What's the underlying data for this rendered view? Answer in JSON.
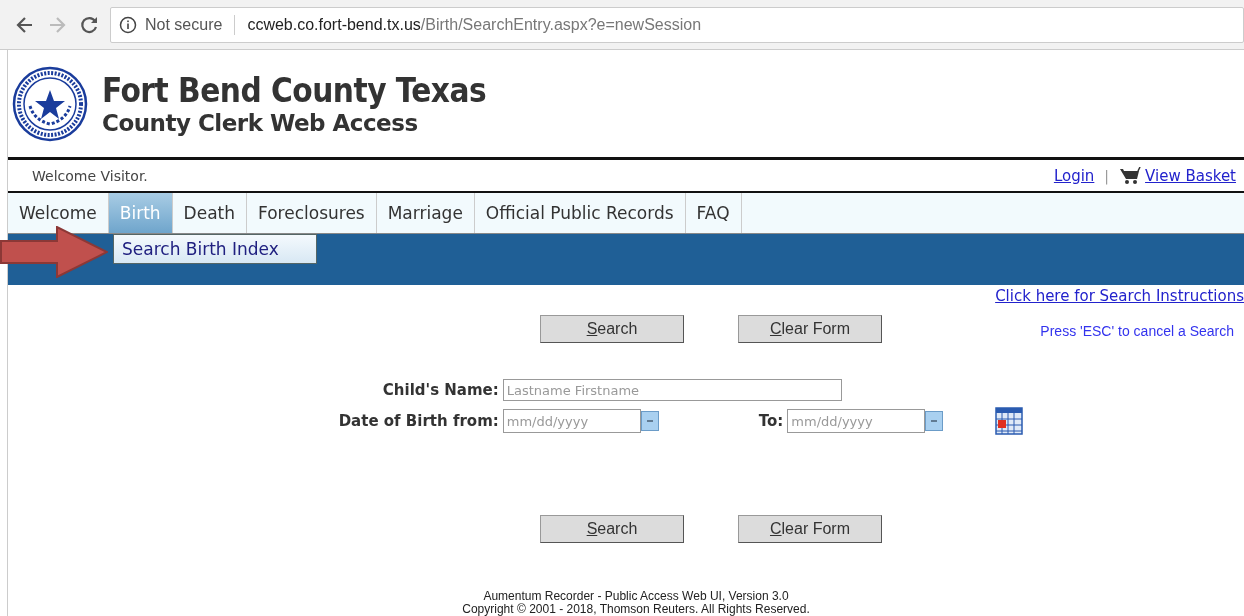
{
  "browser": {
    "security": "Not secure",
    "url_host": "ccweb.co.fort-bend.tx.us",
    "url_path": "/Birth/SearchEntry.aspx?e=newSession"
  },
  "header": {
    "title": "Fort Bend County Texas",
    "subtitle": "County Clerk Web Access"
  },
  "user_bar": {
    "welcome": "Welcome Visitor.",
    "login": "Login",
    "separator": "|",
    "basket": "View Basket"
  },
  "tabs": [
    {
      "label": "Welcome",
      "selected": false
    },
    {
      "label": "Birth",
      "selected": true
    },
    {
      "label": "Death",
      "selected": false
    },
    {
      "label": "Foreclosures",
      "selected": false
    },
    {
      "label": "Marriage",
      "selected": false
    },
    {
      "label": "Official Public Records",
      "selected": false
    },
    {
      "label": "FAQ",
      "selected": false
    }
  ],
  "dropdown": {
    "items": [
      "Search Birth Index"
    ]
  },
  "instructions_link": "Click here for Search Instructions",
  "esc_hint": "Press 'ESC' to cancel a Search",
  "buttons_top": [
    "Search",
    "Clear Form"
  ],
  "form": {
    "child_name": {
      "label": "Child's Name:",
      "placeholder": "Lastname Firstname"
    },
    "dob_from": {
      "label": "Date of Birth from:",
      "placeholder": "mm/dd/yyyy"
    },
    "dob_to": {
      "label": "To:",
      "placeholder": "mm/dd/yyyy"
    }
  },
  "buttons_bottom": [
    "Search",
    "Clear Form"
  ],
  "footer": [
    "Aumentum Recorder - Public Access Web UI, Version 3.0",
    "Copyright © 2001 - 2018, Thomson Reuters. All Rights Reserved."
  ]
}
